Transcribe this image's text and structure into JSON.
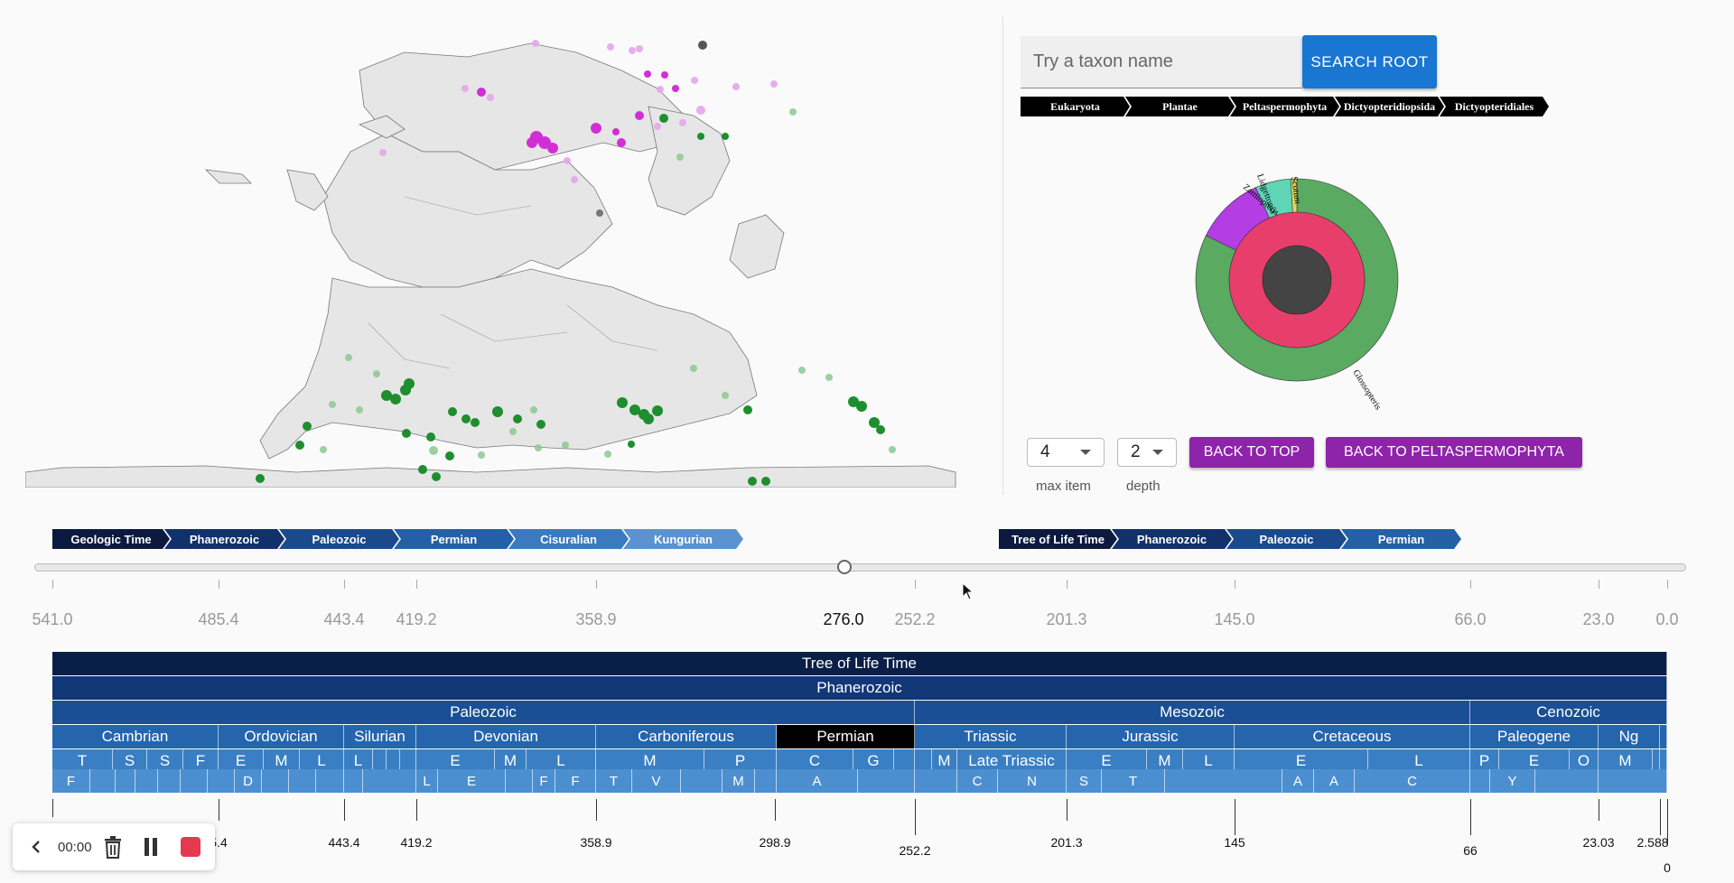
{
  "search": {
    "placeholder": "Try a taxon name",
    "button": "SEARCH ROOT"
  },
  "taxon_breadcrumb": [
    "Eukaryota",
    "Plantae",
    "Peltaspermophyta",
    "Dictyopteridiopsida",
    "Dictyopteridiales"
  ],
  "sunburst": {
    "labels": [
      "Zamiopteris",
      "Lidgettonia",
      "Scutum",
      "Glossopteris"
    ],
    "colors": {
      "outer_main": "#5aaa62",
      "inner": "#e83e6c",
      "center": "#444444",
      "purple": "#b43de4",
      "teal": "#5ed6b6",
      "yellow": "#e0d85a"
    }
  },
  "controls": {
    "max_item": {
      "value": "4",
      "label": "max item"
    },
    "depth": {
      "value": "2",
      "label": "depth"
    },
    "back_top": "BACK TO TOP",
    "back_to": "BACK TO PELTASPERMOPHYTA"
  },
  "geo_breadcrumb": [
    {
      "label": "Geologic Time",
      "color": "#0b1a3e"
    },
    {
      "label": "Phanerozoic",
      "color": "#12306a"
    },
    {
      "label": "Paleozoic",
      "color": "#1a4a8c"
    },
    {
      "label": "Permian",
      "color": "#2460a6"
    },
    {
      "label": "Cisuralian",
      "color": "#3b7abf"
    },
    {
      "label": "Kungurian",
      "color": "#5a93cf"
    }
  ],
  "tol_breadcrumb": [
    {
      "label": "Tree of Life Time",
      "color": "#0b1a3e"
    },
    {
      "label": "Phanerozoic",
      "color": "#12306a"
    },
    {
      "label": "Paleozoic",
      "color": "#1a4a8c"
    },
    {
      "label": "Permian",
      "color": "#2460a6"
    }
  ],
  "slider": {
    "current": "276.0",
    "ticks": [
      "541.0",
      "485.4",
      "443.4",
      "419.2",
      "358.9",
      "276.0",
      "252.2",
      "201.3",
      "145.0",
      "66.0",
      "23.0",
      "0.0"
    ]
  },
  "timescale": {
    "root": "Tree of Life Time",
    "eon": "Phanerozoic",
    "eras": [
      "Paleozoic",
      "Mesozoic",
      "Cenozoic"
    ],
    "periods": [
      "Cambrian",
      "Ordovician",
      "Silurian",
      "Devonian",
      "Carboniferous",
      "Permian",
      "Triassic",
      "Jurassic",
      "Cretaceous",
      "Paleogene",
      "Ng"
    ],
    "epochs": [
      "T",
      "S",
      "S",
      "F",
      "E",
      "M",
      "L",
      "L",
      "E",
      "M",
      "L",
      "M",
      "P",
      "C",
      "G",
      "M",
      "Late Triassic",
      "E",
      "M",
      "L",
      "E",
      "L",
      "P",
      "E",
      "O",
      "M"
    ],
    "ages": [
      "F",
      "D",
      "L",
      "E",
      "F",
      "F",
      "T",
      "V",
      "M",
      "A",
      "C",
      "N",
      "S",
      "T",
      "A",
      "A",
      "C",
      "Y"
    ],
    "axis": [
      "5.4",
      "443.4",
      "419.2",
      "358.9",
      "298.9",
      "252.2",
      "201.3",
      "145",
      "66",
      "23.03",
      "2.588",
      "0"
    ]
  },
  "recorder": {
    "time": "00:00"
  }
}
